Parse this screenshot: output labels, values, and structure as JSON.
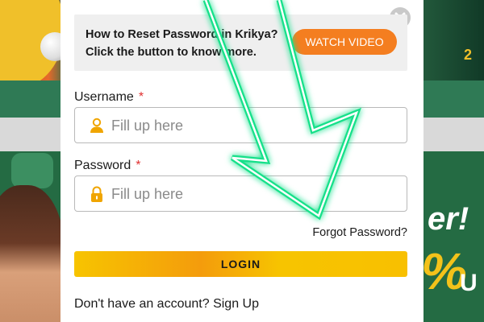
{
  "background": {
    "headline": "er!",
    "percent_glyph": "%",
    "suffix": "U",
    "corner_tag": "2"
  },
  "banner": {
    "text_line1": "How to Reset Password in Krikya?",
    "text_line2": "Click the button to know more.",
    "watch_video_label": "WATCH VIDEO"
  },
  "form": {
    "username_label": "Username",
    "username_placeholder": "Fill up here",
    "password_label": "Password",
    "password_placeholder": "Fill up here",
    "required_mark": "*",
    "forgot_password": "Forgot Password?",
    "login_label": "LOGIN",
    "signup_prompt": "Don't have an account?",
    "signup_link": "Sign Up"
  },
  "colors": {
    "watch_video": "#f47e20",
    "login_gradient_start": "#f7c400",
    "login_gradient_mid": "#f49c0c",
    "icon_accent": "#f0a500",
    "arrow_glow": "#19e08a",
    "required": "#e03030"
  },
  "icons": {
    "close": "close-icon",
    "username": "user-icon",
    "password": "lock-icon",
    "overlay": "arrow-overlay"
  }
}
